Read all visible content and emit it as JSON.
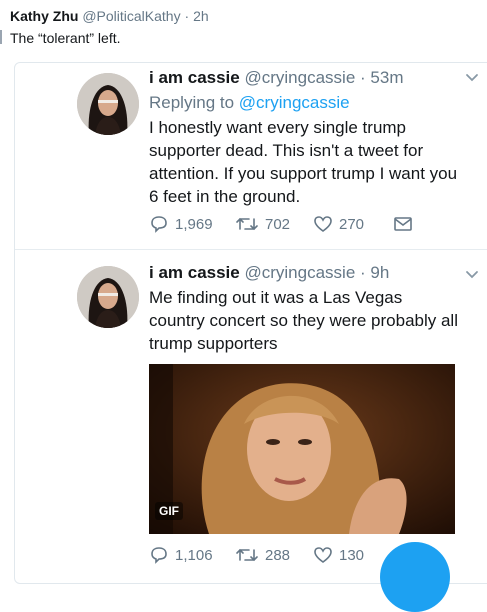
{
  "outer_tweet": {
    "name": "Kathy Zhu",
    "handle": "@PoliticalKathy",
    "separator": "·",
    "time": "2h",
    "text": "The “tolerant” left."
  },
  "quoted_tweets": [
    {
      "name": "i am cassie",
      "handle": "@cryingcassie",
      "separator": "·",
      "time": "53m",
      "reply_prefix": "Replying to",
      "reply_to": "@cryingcassie",
      "text": "I honestly want every single trump supporter dead. This isn't a tweet for attention. If you support trump I want you 6 feet in the ground.",
      "replies": "1,969",
      "retweets": "702",
      "likes": "270"
    },
    {
      "name": "i am cassie",
      "handle": "@cryingcassie",
      "separator": "·",
      "time": "9h",
      "text": "Me finding  out it was a Las Vegas country concert so they were probably all trump supporters",
      "media_badge": "GIF",
      "replies": "1,106",
      "retweets": "288",
      "likes": "130"
    }
  ],
  "icons": [
    "chevron-down-icon",
    "reply-icon",
    "retweet-icon",
    "like-icon",
    "dm-icon"
  ],
  "colors": {
    "link": "#1da1f2",
    "muted": "#657786",
    "text": "#14171a",
    "border": "#e1e8ed"
  }
}
